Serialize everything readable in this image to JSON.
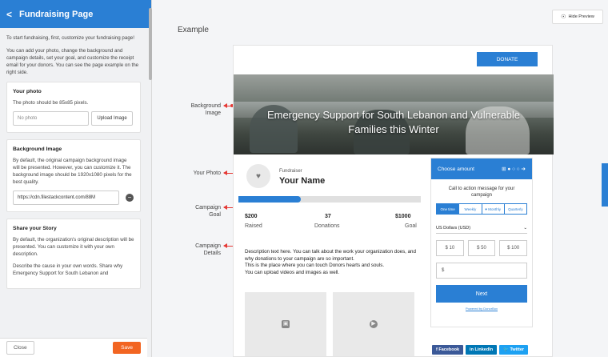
{
  "sidebar": {
    "back_icon": "chevron-left-icon",
    "title": "Fundraising Page",
    "intro1": "To start fundraising, first, customize your fundraising page!",
    "intro2": "You can add your photo, change the background and campaign details, set your goal, and customize the receipt email for your donors. You can see the page example on the right side.",
    "your_photo": {
      "title": "Your photo",
      "desc": "The photo should be 85x85 pixels.",
      "placeholder": "No photo",
      "upload_label": "Upload Image"
    },
    "background_image": {
      "title": "Background Image",
      "desc": "By default, the original campaign background image will be presented. However, you can customize it. The background image should be 1920x1080 pixels for the best quality.",
      "url_value": "https://cdn.filestackcontent.com/88M",
      "remove_icon": "minus-circle-icon"
    },
    "story": {
      "title": "Share your Story",
      "desc1": "By default, the organization's original description will be presented. You can customize it with your own description.",
      "desc2": "Describe the cause in your own words. Share why Emergency Support for South Lebanon and"
    },
    "footer": {
      "close_label": "Close",
      "save_label": "Save"
    }
  },
  "main": {
    "hide_preview_label": "Hide Preview",
    "hide_preview_icon": "eye-off-icon",
    "example_title": "Example",
    "annotations": {
      "background_image": "Background\nImage",
      "your_photo": "Your Photo",
      "campaign_goal": "Campaign\nGoal",
      "campaign_details": "Campaign\nDetails"
    }
  },
  "preview": {
    "donate_label": "DONATE",
    "hero_title_line1": "Emergency Support for South Lebanon and Vulnerable",
    "hero_title_line2": "Families this Winter",
    "fundraiser_label": "Fundraiser",
    "fundraiser_name": "Your Name",
    "avatar_icon": "heart-icon",
    "progress_fraction": 0.34,
    "stats": {
      "raised_value": "$200",
      "raised_label": "Raised",
      "donations_value": "37",
      "donations_label": "Donations",
      "goal_value": "$1000",
      "goal_label": "Goal"
    },
    "description": [
      "Description text here. You can talk about the work your organization does, and why donations to your campaign are so important.",
      "This is the place where you can touch Donors hearts and souls.",
      "You can upload videos and images as well."
    ],
    "media_icons": [
      "image-icon",
      "play-icon"
    ],
    "widget": {
      "header": "Choose amount",
      "steps_indicator": "⊞ ● ○ ○ ➔",
      "cta": "Call to action message for your campaign",
      "frequencies": [
        "One time",
        "Weekly",
        "♥ Monthly",
        "Quarterly"
      ],
      "currency": "US Dollars (USD)",
      "amounts": [
        "$ 10",
        "$ 50",
        "$ 100"
      ],
      "custom_prefix": "$",
      "next_label": "Next",
      "powered_by": "Powered by DonorBox"
    },
    "social": [
      {
        "label": "f  Facebook",
        "color": "#3b5998"
      },
      {
        "label": "in  LinkedIn",
        "color": "#0077b5"
      },
      {
        "label": "🐦 Twitter",
        "color": "#1da1f2"
      }
    ]
  },
  "colors": {
    "primary": "#2a7fd4",
    "save": "#f26522",
    "annotation": "#e53935"
  }
}
